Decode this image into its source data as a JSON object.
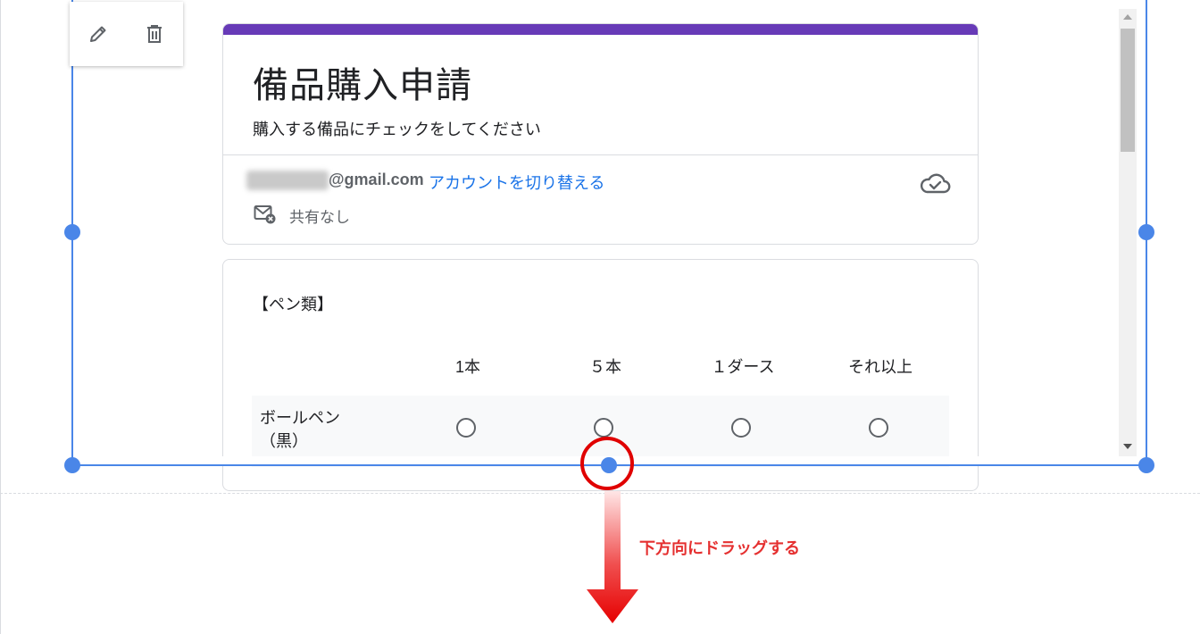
{
  "toolbar": {
    "edit_icon": "pencil-icon",
    "delete_icon": "trash-icon"
  },
  "form": {
    "title": "備品購入申請",
    "description": "購入する備品にチェックをしてください",
    "email_domain": "@gmail.com",
    "switch_account": "アカウントを切り替える",
    "share_status": "共有なし",
    "accent_color": "#673ab7",
    "link_color": "#1a73e8"
  },
  "question": {
    "title": "【ペン類】",
    "columns": [
      "1本",
      "５本",
      "１ダース",
      "それ以上"
    ],
    "rows": [
      {
        "label_line1": "ボールペン",
        "label_line2": "（黒）"
      }
    ]
  },
  "annotation": {
    "instruction": "下方向にドラッグする",
    "color": "#e53030"
  },
  "selection": {
    "handle_color": "#4a86e8"
  }
}
